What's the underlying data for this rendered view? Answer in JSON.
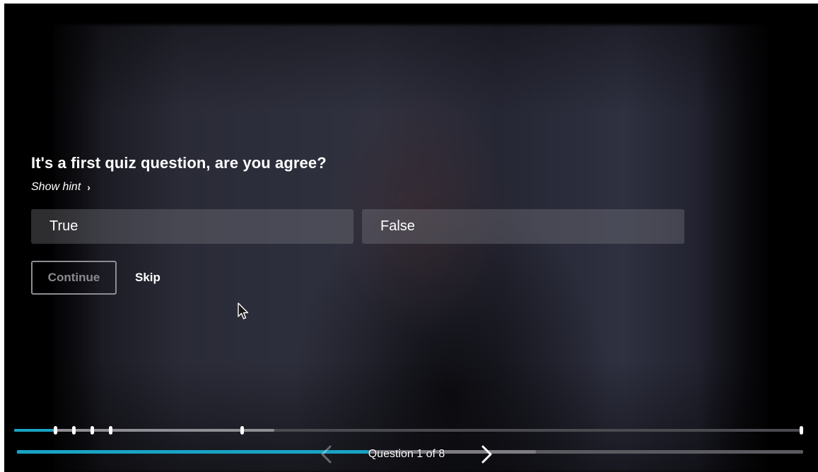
{
  "quiz": {
    "question": "It's a first quiz question, are you agree?",
    "hint_label": "Show hint",
    "answers": [
      {
        "label": "True"
      },
      {
        "label": "False"
      }
    ],
    "continue_label": "Continue",
    "skip_label": "Skip"
  },
  "navigation": {
    "label": "Question 1 of 8",
    "prev_icon": "chevron-left-icon",
    "next_icon": "chevron-right-icon"
  },
  "timeline": {
    "played_fraction": 0.05,
    "buffered_fraction": 0.33,
    "marker_count": 6
  },
  "quiz_progress": {
    "played_fraction": 0.45,
    "buffered_fraction": 0.66
  },
  "colors": {
    "accent": "#1aa3c4",
    "answer_bg": "#5a5a66",
    "continue_disabled": "#8a8a8f"
  }
}
